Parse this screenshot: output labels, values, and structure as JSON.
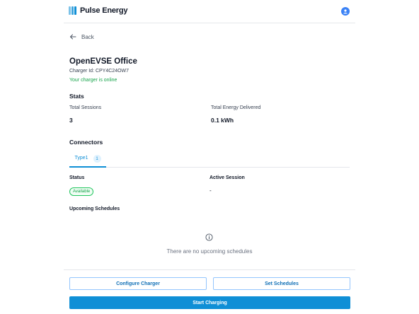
{
  "header": {
    "brand": "Pulse Energy",
    "brand_color": "#0f8fd6",
    "logo_icon": "pulse-energy-logo-icon",
    "avatar_icon": "user-avatar-icon"
  },
  "nav": {
    "back_label": "Back",
    "back_icon": "arrow-left-icon"
  },
  "charger": {
    "name": "OpenEVSE Office",
    "id_text": "Charger Id: CPY4C24OW7",
    "status_text": "Your charger is online",
    "status_color": "#16a34a"
  },
  "stats": {
    "title": "Stats",
    "total_sessions_label": "Total Sessions",
    "total_sessions_value": "3",
    "total_energy_label": "Total Energy Delivered",
    "total_energy_value": "0.1 kWh"
  },
  "connectors": {
    "title": "Connectors",
    "tabs": [
      {
        "label": "Type1",
        "count": "1"
      }
    ],
    "status_label": "Status",
    "status_badge": "Available",
    "active_session_label": "Active Session",
    "active_session_value": "-",
    "upcoming_label": "Upcoming Schedules",
    "empty_icon": "info-circle-icon",
    "empty_text": "There are no upcoming schedules"
  },
  "actions": {
    "configure_label": "Configure Charger",
    "schedules_label": "Set Schedules",
    "start_label": "Start Charging",
    "primary_color": "#0f8fd6"
  }
}
